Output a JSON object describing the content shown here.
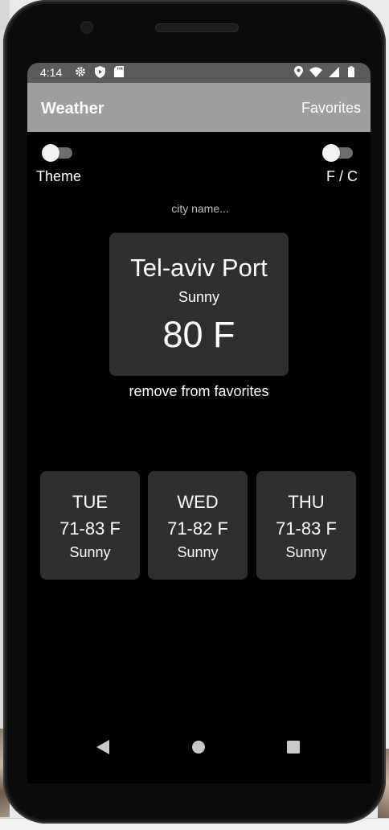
{
  "status_bar": {
    "time": "4:14",
    "left_icons": [
      "gear-icon",
      "play-protect-icon",
      "sd-card-icon"
    ],
    "right_icons": [
      "location-icon",
      "wifi-icon",
      "signal-icon",
      "battery-icon"
    ]
  },
  "app_bar": {
    "title": "Weather",
    "favorites_label": "Favorites"
  },
  "toggles": {
    "theme_label": "Theme",
    "unit_label": "F / C",
    "theme_on": false,
    "unit_on": false
  },
  "search": {
    "placeholder": "city name...",
    "value": ""
  },
  "current": {
    "city": "Tel-aviv Port",
    "condition": "Sunny",
    "temperature": "80 F",
    "remove_label": "remove from favorites"
  },
  "forecast": [
    {
      "day": "TUE",
      "range": "71-83 F",
      "condition": "Sunny"
    },
    {
      "day": "WED",
      "range": "71-82 F",
      "condition": "Sunny"
    },
    {
      "day": "THU",
      "range": "71-83 F",
      "condition": "Sunny"
    }
  ],
  "colors": {
    "app_bar": "#9e9e9e",
    "background": "#000000",
    "card": "#2f2f2f",
    "status_bar": "#5b5b5b"
  },
  "nav": [
    "back-icon",
    "home-icon",
    "recents-icon"
  ]
}
